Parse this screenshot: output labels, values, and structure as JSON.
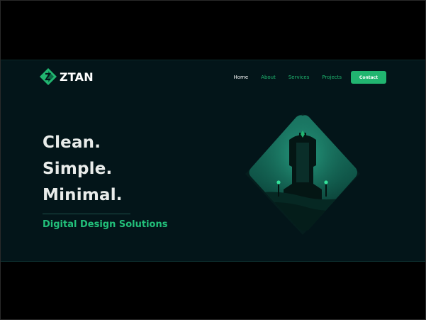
{
  "brand": {
    "name": "ZTAN",
    "logo_icon": "ztan-diamond-logo-icon",
    "accent": "#21b570",
    "background": "#031519"
  },
  "nav": {
    "items": [
      {
        "label": "Home",
        "active": true
      },
      {
        "label": "About",
        "active": false
      },
      {
        "label": "Services",
        "active": false
      },
      {
        "label": "Projects",
        "active": false
      }
    ],
    "cta_label": "Contact"
  },
  "hero": {
    "lines": [
      "Clean.",
      "Simple.",
      "Minimal."
    ],
    "subtitle": "Digital Design Solutions",
    "illustration": "monolith-diamond-illustration"
  }
}
